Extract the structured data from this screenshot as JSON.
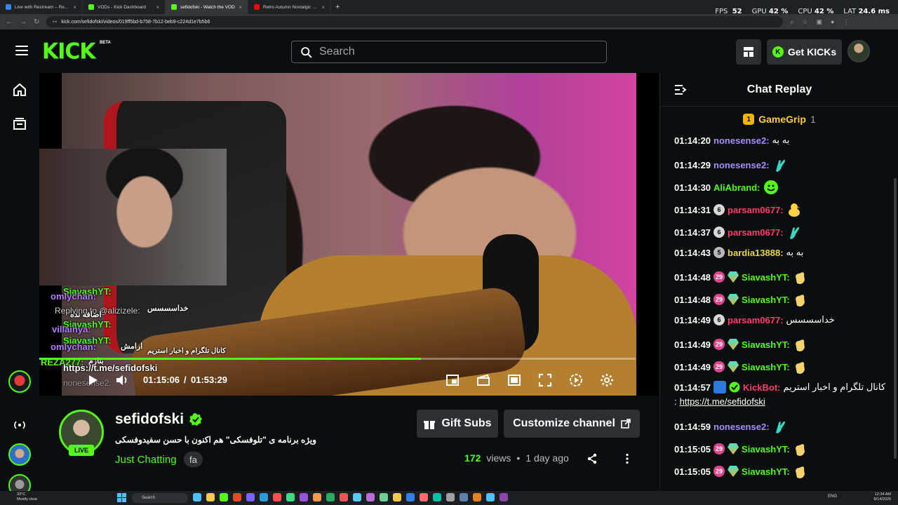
{
  "browser": {
    "tabs": [
      {
        "title": "Live with Restream – Restream",
        "color": "#3b82f6",
        "active": false
      },
      {
        "title": "VODs - Kick Dashboard",
        "color": "#53fc18",
        "active": false
      },
      {
        "title": "sefidofski - Watch the VOD",
        "color": "#53fc18",
        "active": true
      },
      {
        "title": "Retro Autumn Nostalgic Jazz -",
        "color": "#ff0000",
        "active": false
      }
    ],
    "url": "kick.com/sefidofski/videos/019ff5bd-b758-7b12-beb9-c224d1e7b5b6",
    "perf": {
      "fps_label": "FPS",
      "fps": "52",
      "gpu_label": "GPU",
      "gpu": "42 %",
      "cpu_label": "CPU",
      "cpu": "42 %",
      "lat_label": "LAT",
      "lat": "24.6 ms"
    }
  },
  "header": {
    "logo": "KICK",
    "beta": "BETA",
    "search_placeholder": "Search",
    "get_kicks": "Get KICKs"
  },
  "video": {
    "progress_fraction": 0.64,
    "current_time": "01:15:06",
    "separator": "/",
    "duration": "01:53:29",
    "overlay_chat": {
      "lines": [
        {
          "text": "SiavashYT:",
          "cls": "oc-green"
        },
        {
          "text": "omlychan:",
          "cls": "oc-purple"
        },
        {
          "text": "Replying to @alizizele:",
          "cls": "oc-grey"
        },
        {
          "text": "SiavashYT:",
          "cls": "oc-green"
        },
        {
          "text": "villainya:",
          "cls": "oc-purple"
        },
        {
          "text": "omlychan:",
          "cls": "oc-purple"
        },
        {
          "text": "SiavashYT:",
          "cls": "oc-green"
        },
        {
          "text": "REZA277:",
          "cls": "oc-green"
        },
        {
          "text": "https://t.me/sefidofski",
          "cls": "oc-white"
        },
        {
          "text": "nonesense2:",
          "cls": "oc-grey"
        }
      ],
      "persian": [
        "خداسسسس",
        "اضافه نده",
        "ارامش",
        "کانال تلگرام و اخبار استریم",
        "بنازم"
      ]
    }
  },
  "channel": {
    "name": "sefidofski",
    "live_badge": "LIVE",
    "title": "ویژه برنامه ی \"تلوفسکی\" هم اکنون با حسن سفیدوفسکی",
    "category": "Just Chatting",
    "language": "fa",
    "gift_subs": "Gift Subs",
    "customize": "Customize channel",
    "views": "172",
    "views_label": "views",
    "dot": "•",
    "age": "1 day ago"
  },
  "chat": {
    "title": "Chat Replay",
    "pinned": {
      "name": "GameGrip",
      "count": "1"
    },
    "messages": [
      {
        "ts": "01:14:20",
        "badges": [],
        "user": "nonesense2:",
        "ucls": "c-purple",
        "text": "به به",
        "emote": ""
      },
      {
        "ts": "01:14:29",
        "badges": [],
        "user": "nonesense2:",
        "ucls": "c-purple",
        "text": "",
        "emote": "hand"
      },
      {
        "ts": "01:14:30",
        "badges": [],
        "user": "AliAbrand:",
        "ucls": "c-green",
        "text": "",
        "emote": "smile"
      },
      {
        "ts": "01:14:31",
        "badges": [
          "6"
        ],
        "user": "parsam0677:",
        "ucls": "c-red",
        "text": "",
        "emote": "duck"
      },
      {
        "ts": "01:14:37",
        "badges": [
          "6"
        ],
        "user": "parsam0677:",
        "ucls": "c-red",
        "text": "",
        "emote": "hand"
      },
      {
        "ts": "01:14:43",
        "badges": [
          "5"
        ],
        "user": "bardia13888:",
        "ucls": "c-yellow",
        "text": "به به",
        "emote": ""
      },
      {
        "ts": "01:14:48",
        "badges": [
          "29",
          "gem"
        ],
        "user": "SiavashYT:",
        "ucls": "c-green",
        "text": "",
        "emote": "clap"
      },
      {
        "ts": "01:14:48",
        "badges": [
          "29",
          "gem"
        ],
        "user": "SiavashYT:",
        "ucls": "c-green",
        "text": "",
        "emote": "clap"
      },
      {
        "ts": "01:14:49",
        "badges": [
          "6"
        ],
        "user": "parsam0677:",
        "ucls": "c-red",
        "text": "خداسسسس",
        "emote": ""
      },
      {
        "ts": "01:14:49",
        "badges": [
          "29",
          "gem"
        ],
        "user": "SiavashYT:",
        "ucls": "c-green",
        "text": "",
        "emote": "clap"
      },
      {
        "ts": "01:14:49",
        "badges": [
          "29",
          "gem"
        ],
        "user": "SiavashYT:",
        "ucls": "c-green",
        "text": "",
        "emote": "clap"
      },
      {
        "ts": "01:14:57",
        "badges": [
          "bot",
          "ver"
        ],
        "user": "KickBot:",
        "ucls": "c-red",
        "text": "کانال تلگرام و اخبار استریم",
        "emote": ""
      },
      {
        "ts": "01:14:59",
        "badges": [],
        "user": "nonesense2:",
        "ucls": "c-purple",
        "text": "",
        "emote": "hand"
      },
      {
        "ts": "01:15:05",
        "badges": [
          "29",
          "gem"
        ],
        "user": "SiavashYT:",
        "ucls": "c-green",
        "text": "",
        "emote": "clap"
      },
      {
        "ts": "01:15:05",
        "badges": [
          "29",
          "gem"
        ],
        "user": "SiavashYT:",
        "ucls": "c-green",
        "text": "",
        "emote": "clap"
      }
    ],
    "kickbot_link": "https://t.me/sefidofski",
    "kickbot_prefix": ":"
  },
  "taskbar": {
    "weather_temp": "33°C",
    "weather_desc": "Mostly clear",
    "search": "Search",
    "lang": "ENG",
    "time": "12:34 AM",
    "date": "8/14/2026"
  },
  "colors": {
    "brand": "#53fc18",
    "bg": "#0b0e0f",
    "panel": "#2c3033"
  }
}
